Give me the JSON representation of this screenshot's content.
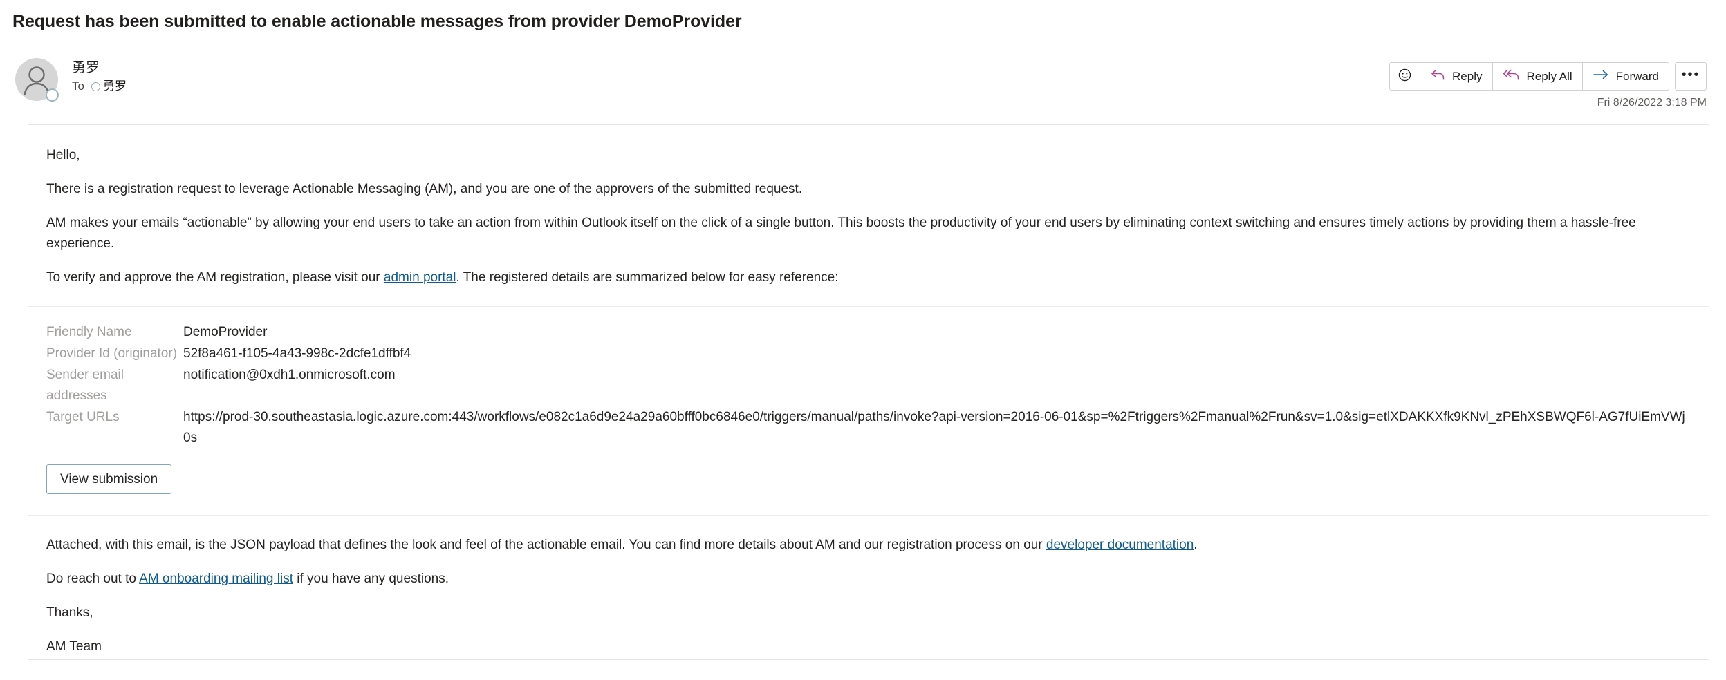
{
  "subject": "Request has been submitted to enable actionable messages from provider DemoProvider",
  "header": {
    "sender_name": "勇罗",
    "to_label": "To",
    "recipient": "勇罗",
    "timestamp": "Fri 8/26/2022 3:18 PM"
  },
  "actions": {
    "emoji_icon": "smiley-icon",
    "reply_label": "Reply",
    "reply_all_label": "Reply All",
    "forward_label": "Forward",
    "more_label": "•••"
  },
  "body": {
    "greeting": "Hello,",
    "paragraph_1": "There is a registration request to leverage Actionable Messaging (AM), and you are one of the approvers of the submitted request.",
    "paragraph_2": "AM makes your emails “actionable” by allowing your end users to take an action from within Outlook itself on the click of a single button. This boosts the productivity of your end users by eliminating context switching and ensures timely actions by providing them a hassle-free experience.",
    "paragraph_3_before": "To verify and approve the AM registration, please visit our ",
    "paragraph_3_link": "admin portal",
    "paragraph_3_after": ". The registered details are summarized below for easy reference:",
    "details": [
      {
        "label": "Friendly Name",
        "value": "DemoProvider"
      },
      {
        "label": "Provider Id (originator)",
        "value": "52f8a461-f105-4a43-998c-2dcfe1dffbf4"
      },
      {
        "label": "Sender email addresses",
        "value": "notification@0xdh1.onmicrosoft.com"
      },
      {
        "label": "Target URLs",
        "value": "https://prod-30.southeastasia.logic.azure.com:443/workflows/e082c1a6d9e24a29a60bfff0bc6846e0/triggers/manual/paths/invoke?api-version=2016-06-01&sp=%2Ftriggers%2Fmanual%2Frun&sv=1.0&sig=etlXDAKKXfk9KNvl_zPEhXSBWQF6l-AG7fUiEmVWj0s"
      }
    ],
    "view_submission_label": "View submission",
    "attached_before": "Attached, with this email, is the JSON payload that defines the look and feel of the actionable email. You can find more details about AM and our registration process on our ",
    "attached_link": "developer documentation",
    "attached_after": ".",
    "reach_out_before": "Do reach out to ",
    "reach_out_link": "AM onboarding mailing list",
    "reach_out_after": " if you have any questions.",
    "thanks": "Thanks,",
    "signature": "AM Team"
  },
  "colors": {
    "link": "#0f5a8f",
    "reply_icon": "#b5478f",
    "forward_icon": "#0f6cbd",
    "label_gray": "#a19f9d"
  }
}
